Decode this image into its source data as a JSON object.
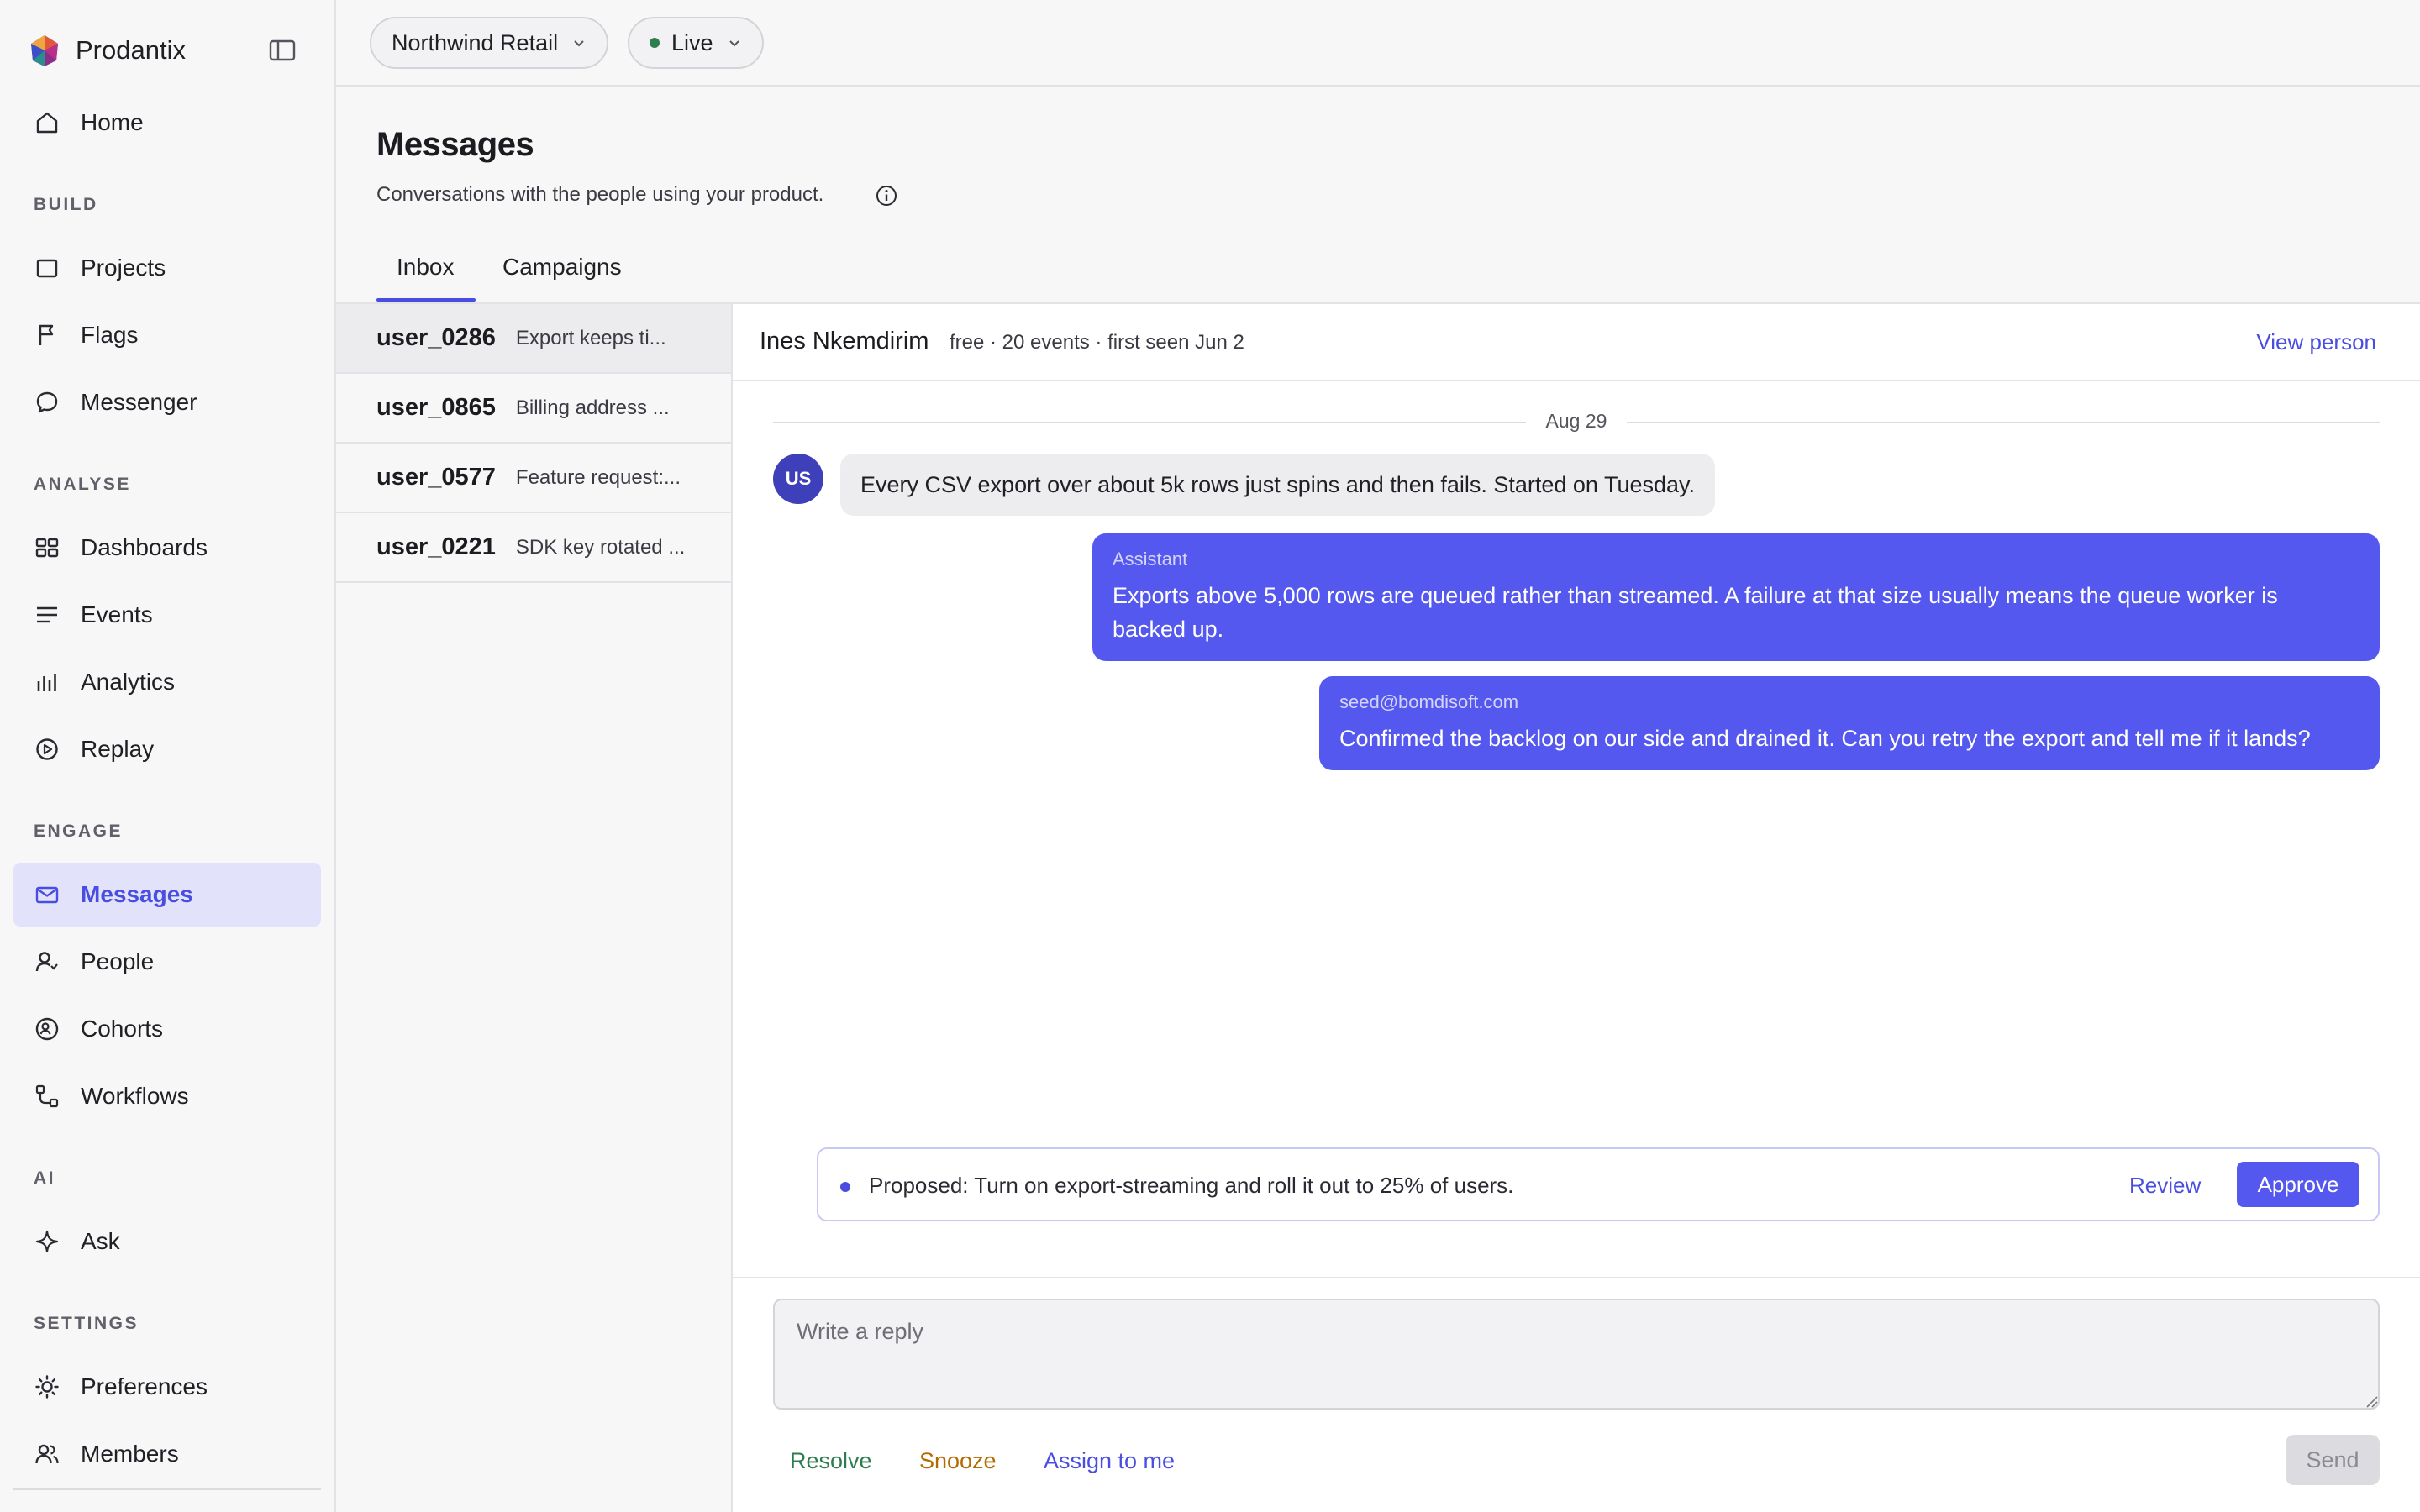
{
  "app": {
    "name": "Prodantix"
  },
  "sidebar": {
    "home": {
      "label": "Home",
      "icon": "home-icon"
    },
    "sections": [
      {
        "label": "BUILD",
        "items": [
          {
            "label": "Projects",
            "icon": "square-icon"
          },
          {
            "label": "Flags",
            "icon": "flag-icon"
          },
          {
            "label": "Messenger",
            "icon": "chat-bubble-icon"
          }
        ]
      },
      {
        "label": "ANALYSE",
        "items": [
          {
            "label": "Dashboards",
            "icon": "dashboard-icon"
          },
          {
            "label": "Events",
            "icon": "lines-icon"
          },
          {
            "label": "Analytics",
            "icon": "bar-chart-icon"
          },
          {
            "label": "Replay",
            "icon": "play-circle-icon"
          }
        ]
      },
      {
        "label": "ENGAGE",
        "items": [
          {
            "label": "Messages",
            "icon": "mail-icon",
            "active": true
          },
          {
            "label": "People",
            "icon": "person-icon"
          },
          {
            "label": "Cohorts",
            "icon": "cohort-icon"
          },
          {
            "label": "Workflows",
            "icon": "workflow-icon"
          }
        ]
      },
      {
        "label": "AI",
        "items": [
          {
            "label": "Ask",
            "icon": "sparkle-icon"
          }
        ]
      },
      {
        "label": "SETTINGS",
        "items": [
          {
            "label": "Preferences",
            "icon": "sun-icon"
          },
          {
            "label": "Members",
            "icon": "members-icon"
          }
        ]
      }
    ]
  },
  "topbar": {
    "workspace": "Northwind Retail",
    "environment": "Live"
  },
  "page": {
    "title": "Messages",
    "subtitle": "Conversations with the people using your product.",
    "tabs": [
      {
        "label": "Inbox",
        "active": true
      },
      {
        "label": "Campaigns"
      }
    ]
  },
  "conversations": [
    {
      "user": "user_0286",
      "preview": "Export keeps ti...",
      "selected": true
    },
    {
      "user": "user_0865",
      "preview": "Billing address ..."
    },
    {
      "user": "user_0577",
      "preview": "Feature request:..."
    },
    {
      "user": "user_0221",
      "preview": "SDK key rotated ..."
    }
  ],
  "thread": {
    "person_name": "Ines Nkemdirim",
    "person_meta": "free · 20 events · first seen Jun 2",
    "view_person": "View person",
    "day": "Aug 29",
    "avatar_initials": "US",
    "incoming": "Every CSV export over about 5k rows just spins and then fails. Started on Tuesday.",
    "assistant": {
      "sender": "Assistant",
      "line1": "Exports above 5,000 rows are queued rather than streamed. A failure at that size usually means the queue worker is",
      "line2": "backed up."
    },
    "operator": {
      "sender": "seed@bomdisoft.com",
      "body": "Confirmed the backlog on our side and drained it. Can you retry the export and tell me if it lands?"
    },
    "proposal": {
      "text": "Proposed: Turn on export-streaming and roll it out to 25% of users.",
      "review": "Review",
      "approve": "Approve"
    }
  },
  "composer": {
    "placeholder": "Write a reply",
    "value": "",
    "resolve": "Resolve",
    "snooze": "Snooze",
    "assign": "Assign to me",
    "send": "Send"
  },
  "colors": {
    "accent": "#5458ee",
    "accent_text": "#4a4ee0",
    "live": "#2e7d4f",
    "resolve": "#2e7d4f",
    "snooze": "#b36b00",
    "active_nav_bg": "#e2e3fb"
  }
}
